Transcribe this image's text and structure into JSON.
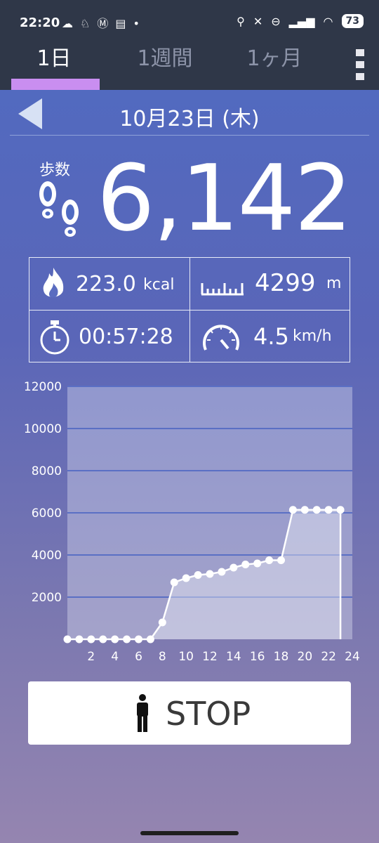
{
  "status_bar": {
    "time": "22:20",
    "battery": "73",
    "left_icons": [
      "cloud-icon",
      "fox-icon",
      "m-icon",
      "news-icon",
      "dot-icon"
    ],
    "right_icons": [
      "location-icon",
      "mute-icon",
      "dnd-icon",
      "signal-icon",
      "wifi-icon"
    ]
  },
  "tabs": [
    {
      "label": "1日",
      "active": true
    },
    {
      "label": "1週間",
      "active": false
    },
    {
      "label": "1ヶ月",
      "active": false
    }
  ],
  "date": "10月23日 (木)",
  "steps": {
    "label": "歩数",
    "value": "6,142"
  },
  "stats": {
    "calories": {
      "value": "223.0",
      "unit": "kcal"
    },
    "distance": {
      "value": "4299",
      "unit": "m"
    },
    "time": {
      "value": "00:57:28"
    },
    "speed": {
      "value": "4.5",
      "unit": "km/h"
    }
  },
  "chart_data": {
    "type": "area",
    "x": [
      0,
      1,
      2,
      3,
      4,
      5,
      6,
      7,
      8,
      9,
      10,
      11,
      12,
      13,
      14,
      15,
      16,
      17,
      18,
      19,
      20,
      21,
      22,
      23
    ],
    "values": [
      0,
      0,
      0,
      0,
      0,
      0,
      0,
      0,
      800,
      2700,
      2900,
      3050,
      3100,
      3200,
      3400,
      3550,
      3600,
      3750,
      3750,
      6142,
      6142,
      6142,
      6142,
      6142
    ],
    "xticks": [
      "2",
      "4",
      "6",
      "8",
      "10",
      "12",
      "14",
      "16",
      "18",
      "20",
      "22",
      "24"
    ],
    "yticks": [
      "2000",
      "4000",
      "6000",
      "8000",
      "10000",
      "12000"
    ],
    "xlim": [
      0,
      24
    ],
    "ylim": [
      0,
      12000
    ],
    "grid": true
  },
  "stop_button": {
    "label": "STOP"
  }
}
